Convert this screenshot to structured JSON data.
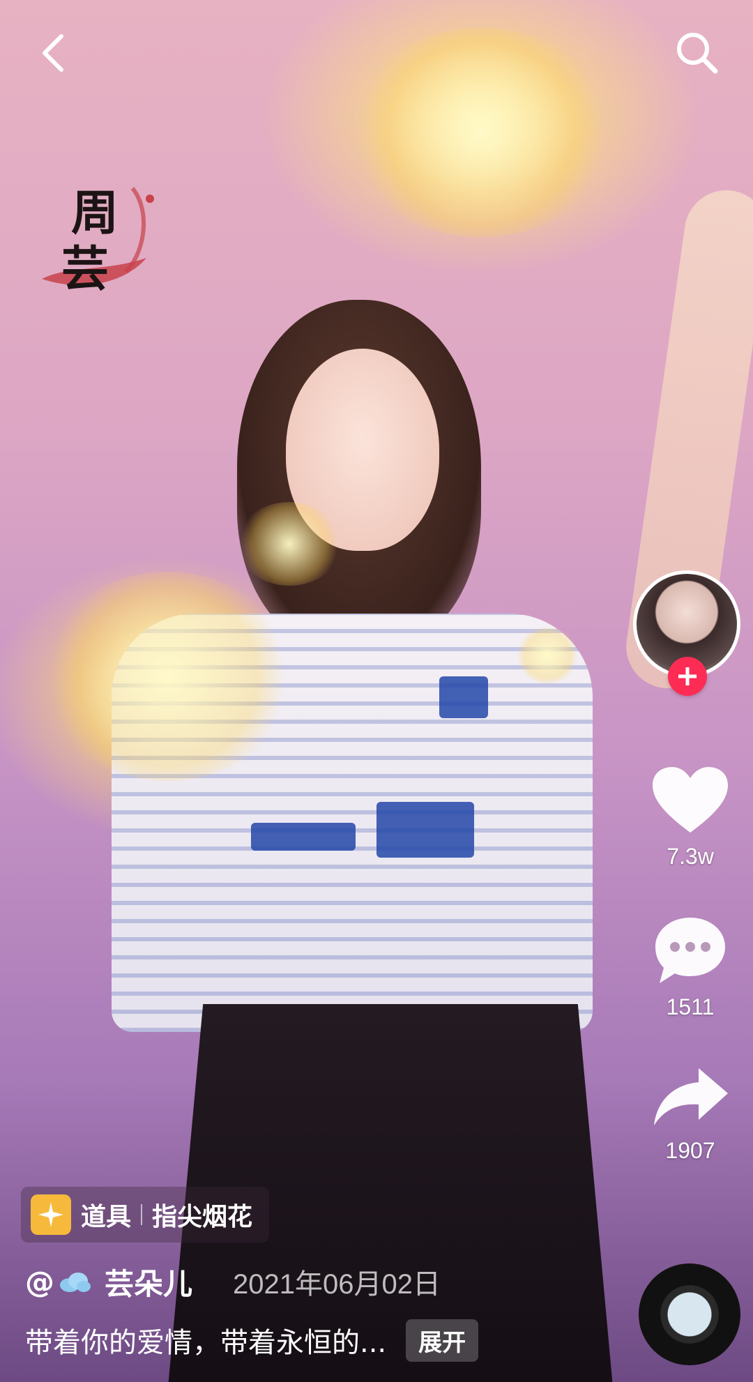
{
  "video": {
    "watermark_text": [
      "周",
      "芸"
    ]
  },
  "topbar": {
    "back_icon": "chevron-left-icon",
    "search_icon": "search-icon"
  },
  "right_rail": {
    "like_count": "7.3w",
    "comment_count": "1511",
    "share_count": "1907",
    "follow_color": "#fe2c55"
  },
  "effect": {
    "label": "道具",
    "name": "指尖烟花",
    "icon_color": "#f6b93b"
  },
  "post": {
    "author": "@",
    "author_name": "芸朵儿",
    "date": "2021年06月02日",
    "caption": "带着你的爱情，带着永恒的...",
    "expand_label": "展开"
  }
}
